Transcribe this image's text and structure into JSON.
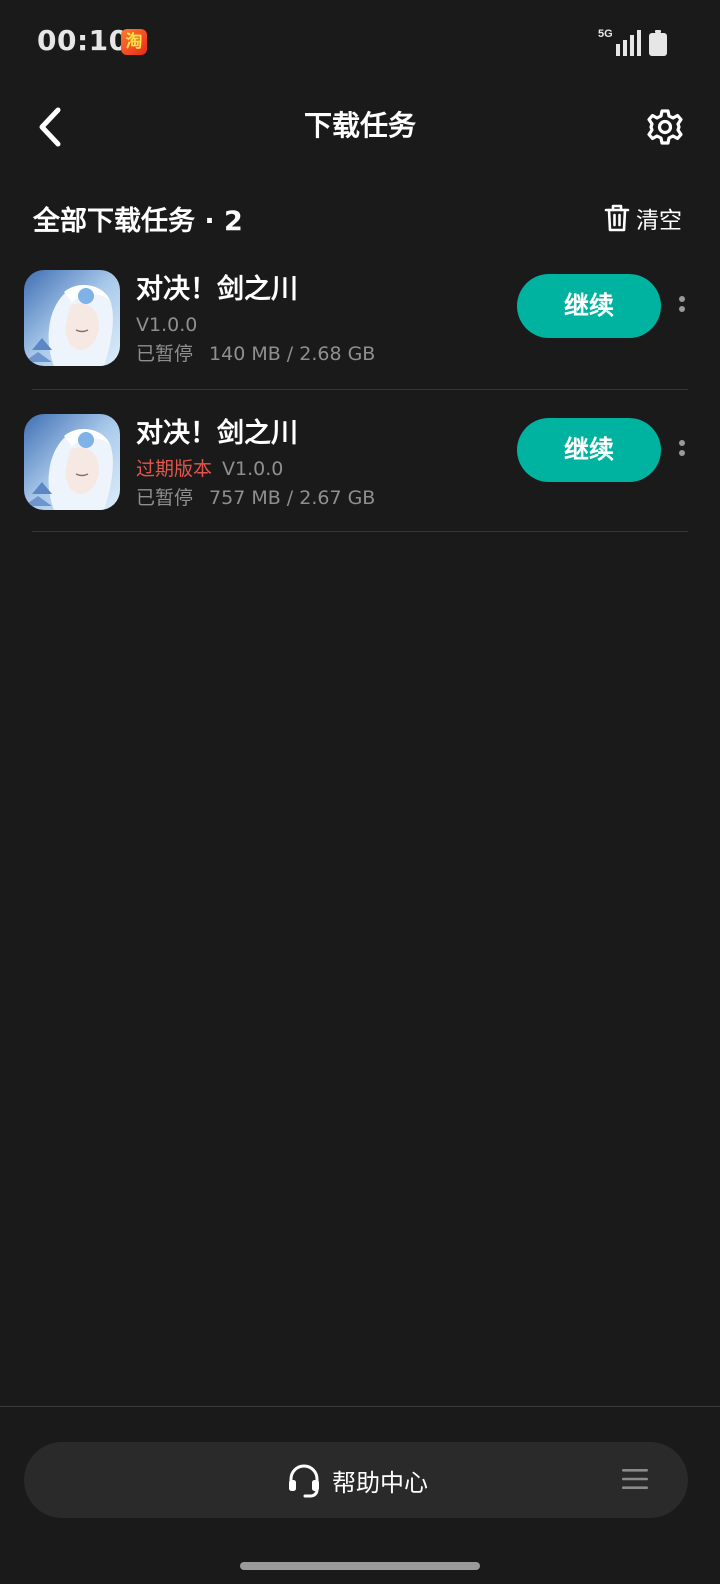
{
  "status_bar": {
    "time": "00:10",
    "notification_app_icon": "taobao-icon",
    "taobao_glyph": "淘",
    "network": "5G",
    "signal_icon": "signal-bars-icon",
    "battery_icon": "battery-icon"
  },
  "header": {
    "title": "下载任务",
    "back_icon": "chevron-left-icon",
    "settings_icon": "gear-icon"
  },
  "section": {
    "title": "全部下载任务 · 2",
    "clear_label": "清空",
    "clear_icon": "trash-icon"
  },
  "tasks": [
    {
      "name": "对决！剑之川",
      "expired_tag": "",
      "version": "V1.0.0",
      "status": "已暂停",
      "progress": "140 MB / 2.68 GB",
      "action_label": "继续"
    },
    {
      "name": "对决！剑之川",
      "expired_tag": "过期版本",
      "version": "V1.0.0",
      "status": "已暂停",
      "progress": "757 MB / 2.67 GB",
      "action_label": "继续"
    }
  ],
  "bottom": {
    "help_label": "帮助中心",
    "help_icon": "headset-icon",
    "menu_icon": "menu-icon"
  },
  "colors": {
    "background": "#1a1a1a",
    "accent": "#00b2a0",
    "expired": "#e2554b",
    "muted_text": "#8f8f8f"
  }
}
